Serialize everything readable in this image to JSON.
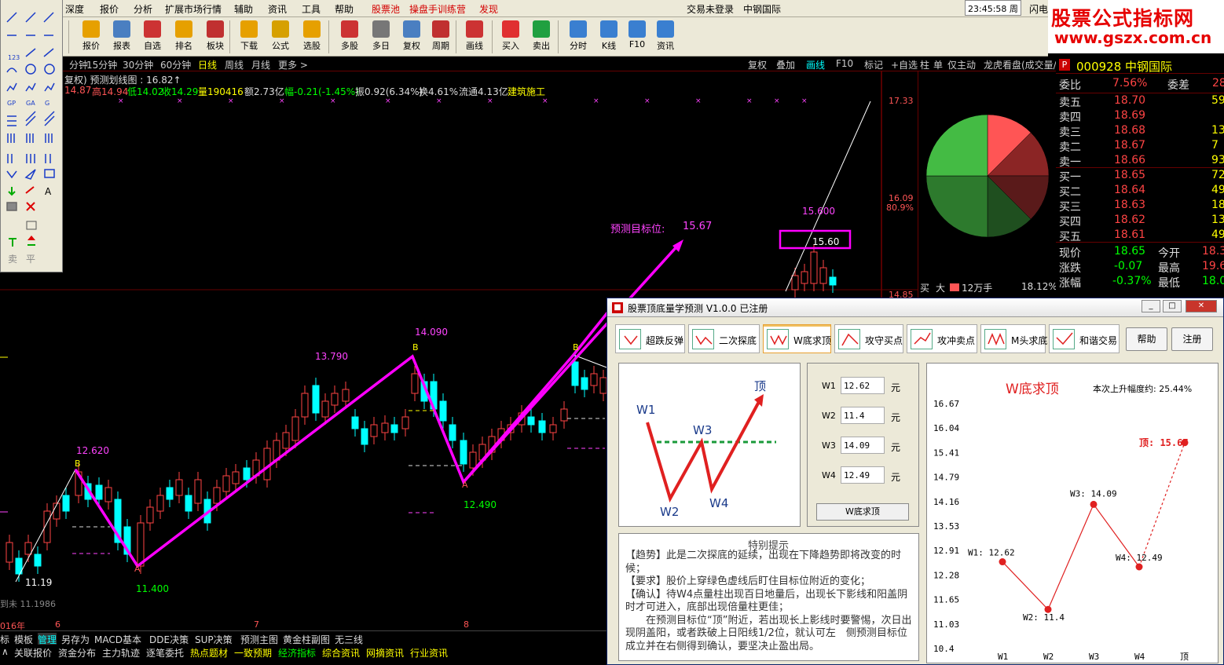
{
  "menu": {
    "items": [
      "深度",
      "报价",
      "分析",
      "扩展市场行情",
      "辅助",
      "资讯",
      "工具",
      "帮助"
    ],
    "red_items": [
      "股票池",
      "操盘手训练营",
      "发现"
    ],
    "status": "交易未登录",
    "stock_name": "中钢国际",
    "clock": "23:45:58 周一",
    "extra": "闪电"
  },
  "logo": {
    "line1": "股票公式指标网",
    "line2": "www.gszx.com.cn"
  },
  "toolbar": [
    "报价",
    "报表",
    "自选",
    "排名",
    "板块",
    "下载",
    "公式",
    "选股",
    "多股",
    "多日",
    "复权",
    "周期",
    "画线",
    "买入",
    "卖出",
    "分时",
    "K线",
    "F10",
    "资讯"
  ],
  "drawtools": {
    "labels": [
      "卖",
      "平"
    ]
  },
  "periods": [
    "分钟",
    "15分钟",
    "30分钟",
    "60分钟",
    "日线",
    "周线",
    "月线",
    "更多 >"
  ],
  "period_active": "日线",
  "right_tabs": [
    "复权",
    "叠加",
    "画线",
    "F10",
    "标记",
    "+自选"
  ],
  "right_tabs2": [
    "柱",
    "单",
    "仅主动",
    "龙虎看盘(成交量/线"
  ],
  "chart_header": {
    "title": "复权) 预测划线图 : 16.82↑",
    "open": "14.87",
    "high": "高14.94",
    "low": "低14.02",
    "close": "收14.29",
    "vol": "量190416",
    "amount": "额2.73亿",
    "change": "幅-0.21(-1.45%)",
    "amp": "振0.92(6.34%)",
    "turnover": "换4.61%",
    "float": "流通4.13亿",
    "sector": "建筑施工"
  },
  "chart_labels": {
    "target_text": "预测目标位:",
    "target_value": "15.67",
    "pivot_1119": "11.19",
    "pivot_12620": "12.620",
    "pivot_11400": "11.400",
    "pivot_13790": "13.790",
    "pivot_14090": "14.090",
    "pivot_12490": "12.490",
    "pivot_15600": "15.600",
    "box_label": "15.60",
    "b": "B",
    "a": "A",
    "axis_1733": "17.33",
    "axis_1609": "16.09",
    "axis_809": "80.9%",
    "axis_1485": "14.85",
    "date_2016": "016年",
    "date_6": "6",
    "date_7": "7",
    "date_8": "8",
    "left_text": "到未 11.1986"
  },
  "bottom_tabs": [
    "标",
    "模板",
    "管理",
    "另存为",
    "MACD基本",
    "DDE决策",
    "SUP决策",
    "预测主图",
    "黄金柱副图",
    "无三线"
  ],
  "bottom_tabs_active": "管理",
  "bottom_tabs2": [
    {
      "t": "关联报价",
      "c": "#ddd"
    },
    {
      "t": "资金分布",
      "c": "#ddd"
    },
    {
      "t": "主力轨迹",
      "c": "#ddd"
    },
    {
      "t": "逐笔委托",
      "c": "#ddd"
    },
    {
      "t": "热点题材",
      "c": "#ffff00"
    },
    {
      "t": "一致预期",
      "c": "#ffff00"
    },
    {
      "t": "经济指标",
      "c": "#00ff00"
    },
    {
      "t": "综合资讯",
      "c": "#ffff00"
    },
    {
      "t": "网摘资讯",
      "c": "#ffff00"
    },
    {
      "t": "行业资讯",
      "c": "#ffff00"
    }
  ],
  "quote": {
    "code_name": "000928 中钢国际",
    "p_icon": "P",
    "weibi_label": "委比",
    "weibi_value": "7.56%",
    "weicha_label": "委差",
    "weicha_value": "28",
    "asks": [
      {
        "l": "卖五",
        "p": "18.70",
        "v": "59"
      },
      {
        "l": "卖四",
        "p": "18.69",
        "v": ""
      },
      {
        "l": "卖三",
        "p": "18.68",
        "v": "13"
      },
      {
        "l": "卖二",
        "p": "18.67",
        "v": "7"
      },
      {
        "l": "卖一",
        "p": "18.66",
        "v": "93"
      }
    ],
    "bids": [
      {
        "l": "买一",
        "p": "18.65",
        "v": "72"
      },
      {
        "l": "买二",
        "p": "18.64",
        "v": "49"
      },
      {
        "l": "买三",
        "p": "18.63",
        "v": "18"
      },
      {
        "l": "买四",
        "p": "18.62",
        "v": "13"
      },
      {
        "l": "买五",
        "p": "18.61",
        "v": "49"
      }
    ],
    "now_label": "现价",
    "now": "18.65",
    "open_label": "今开",
    "open": "18.3",
    "chg_label": "涨跌",
    "chg": "-0.07",
    "high_label": "最高",
    "high": "19.6",
    "pct_label": "涨幅",
    "pct": "-0.37%",
    "low_label": "最低",
    "low": "18.0"
  },
  "pie": {
    "footer_buy": "买",
    "footer_big": "大",
    "footer_unit": "12万手",
    "footer_pct": "18.12%",
    "colors": [
      "#ff5555",
      "#8b2525",
      "#5a1a1a",
      "#1f4f1f",
      "#2d7a2d",
      "#44bb44"
    ]
  },
  "dialog": {
    "title": "股票顶底量学预测 V1.0.0  已注册",
    "tabs": [
      "超跌反弹",
      "二次探底",
      "W底求顶",
      "攻守买点",
      "攻冲卖点",
      "M头求底",
      "和谐交易"
    ],
    "active_tab": "W底求顶",
    "help": "帮助",
    "register": "注册",
    "diagram": {
      "w1": "W1",
      "w2": "W2",
      "w3": "W3",
      "w4": "W4",
      "top": "顶"
    },
    "inputs": [
      {
        "label": "W1",
        "value": "12.62",
        "unit": "元"
      },
      {
        "label": "W2",
        "value": "11.4",
        "unit": "元"
      },
      {
        "label": "W3",
        "value": "14.09",
        "unit": "元"
      },
      {
        "label": "W4",
        "value": "12.49",
        "unit": "元"
      }
    ],
    "calc_button": "W底求顶",
    "notes_title": "特别提示",
    "notes": [
      "【趋势】此是二次探底的延续，出现在下降趋势即将改变的时候；",
      "【要求】股价上穿绿色虚线后盯住目标位附近的变化；",
      "【确认】待W4点量柱出现百日地量后，出现长下影线和阳盖阴时才可进入，底部出现倍量柱更佳；",
      "　　在预测目标位“顶”附近，若出现长上影线时要警惕，次日出现阴盖阳，或者跌破上日阳线1/2位，就认可左　侧预测目标位成立并在右侧得到确认，要坚决止盈出局。"
    ],
    "chart_title": "W底求顶",
    "chart_rise": "本次上升幅度约: 25.44%"
  },
  "chart_data": {
    "type": "line",
    "title": "W底求顶",
    "categories": [
      "W1",
      "W2",
      "W3",
      "W4",
      "顶"
    ],
    "values": [
      12.62,
      11.4,
      14.09,
      12.49,
      15.67
    ],
    "point_labels": [
      "W1: 12.62",
      "W2: 11.4",
      "W3: 14.09",
      "W4: 12.49",
      "顶: 15.67"
    ],
    "yticks": [
      "16.67",
      "16.04",
      "15.41",
      "14.79",
      "14.16",
      "13.53",
      "12.91",
      "12.28",
      "11.65",
      "11.03",
      "10.4"
    ],
    "ylim": [
      10.4,
      16.67
    ]
  }
}
